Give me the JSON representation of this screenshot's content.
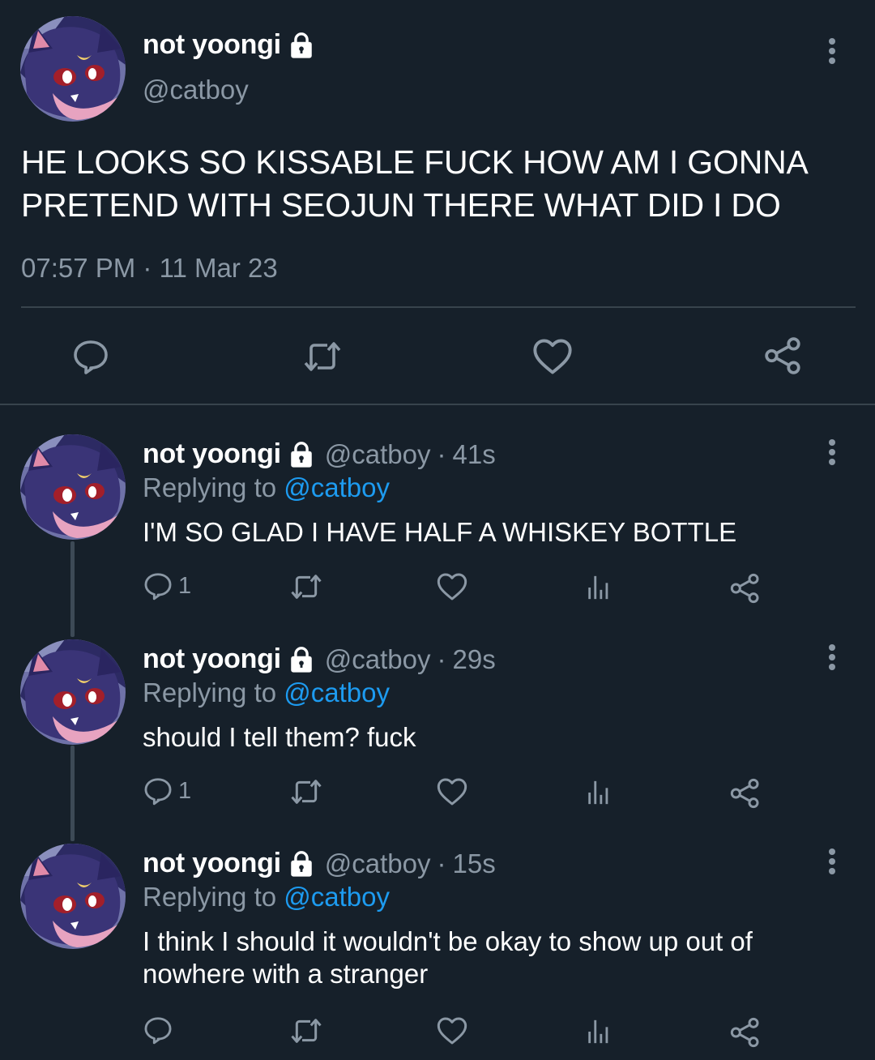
{
  "main_tweet": {
    "display_name": "not yoongi",
    "handle": "@catboy",
    "text": "HE LOOKS SO KISSABLE FUCK HOW AM I GONNA PRETEND WITH SEOJUN THERE WHAT DID I DO",
    "time": "07:57 PM",
    "separator": "·",
    "date": "11 Mar 23",
    "actions": [
      "reply-icon",
      "retweet-icon",
      "like-icon",
      "share-icon"
    ]
  },
  "replies": [
    {
      "display_name": "not yoongi",
      "handle": "@catboy",
      "separator": "·",
      "time": "41s",
      "replying_prefix": "Replying to",
      "replying_to": "@catboy",
      "text": "I'M SO GLAD I HAVE HALF A WHISKEY BOTTLE",
      "reply_count": "1"
    },
    {
      "display_name": "not yoongi",
      "handle": "@catboy",
      "separator": "·",
      "time": "29s",
      "replying_prefix": "Replying to",
      "replying_to": "@catboy",
      "text": "should I tell them? fuck",
      "reply_count": "1"
    },
    {
      "display_name": "not yoongi",
      "handle": "@catboy",
      "separator": "·",
      "time": "15s",
      "replying_prefix": "Replying to",
      "replying_to": "@catboy",
      "text": "I think I should it wouldn't be okay to show up out of nowhere with a stranger",
      "reply_count": ""
    }
  ],
  "colors": {
    "background": "#16202a",
    "text_primary": "#ffffff",
    "text_secondary": "#8b98a5",
    "link": "#1d9bf0",
    "divider": "#38444d"
  }
}
